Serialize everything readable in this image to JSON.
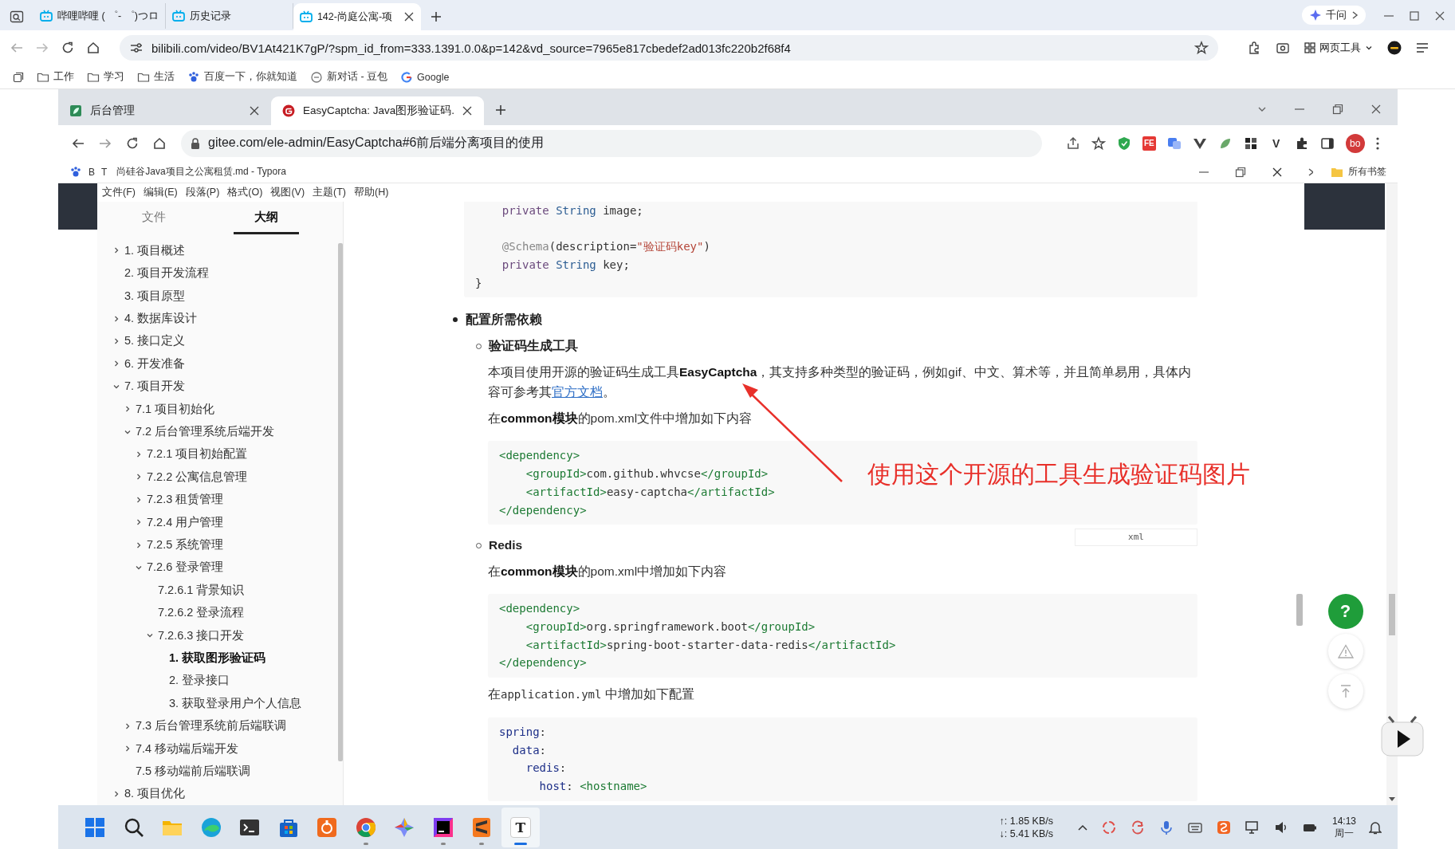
{
  "outer_browser": {
    "tabs": [
      {
        "title": "哔哩哔哩 ( ゜- ゜)つロ",
        "selected": false
      },
      {
        "title": "历史记录",
        "selected": false
      },
      {
        "title": "142-尚庭公寓-项",
        "selected": true
      }
    ],
    "assistant": "千问",
    "address": "bilibili.com/video/BV1At421K7gP/?spm_id_from=333.1391.0.0&p=142&vd_source=7965e817cbedef2ad013fc220b2f68f4",
    "tools_label": "网页工具",
    "bookmarks": [
      {
        "label": "工作",
        "kind": "folder"
      },
      {
        "label": "学习",
        "kind": "folder"
      },
      {
        "label": "生活",
        "kind": "folder"
      },
      {
        "label": "百度一下，你就知道",
        "kind": "baidu"
      },
      {
        "label": "新对话 - 豆包",
        "kind": "chat"
      },
      {
        "label": "Google",
        "kind": "google"
      }
    ]
  },
  "inner_browser": {
    "tabs": [
      {
        "title": "后台管理",
        "selected": false
      },
      {
        "title": "EasyCaptcha: Java图形验证码.",
        "selected": true
      }
    ],
    "address": "gitee.com/ele-admin/EasyCaptcha#6前后端分离项目的使用",
    "extensions": [
      {
        "kind": "shield"
      },
      {
        "kind": "badge",
        "text": "FE"
      },
      {
        "kind": "translate"
      },
      {
        "kind": "vue"
      },
      {
        "kind": "leaf"
      },
      {
        "kind": "blocks"
      },
      {
        "kind": "letter",
        "text": "V"
      },
      {
        "kind": "puzzle"
      },
      {
        "kind": "panel"
      }
    ],
    "profile": "bo",
    "bookmark_letters": [
      "B",
      "T"
    ],
    "all_bookmarks": "所有书签"
  },
  "typora": {
    "title": "尚硅谷Java项目之公寓租赁.md - Typora",
    "menu": [
      "文件(F)",
      "编辑(E)",
      "段落(P)",
      "格式(O)",
      "视图(V)",
      "主题(T)",
      "帮助(H)"
    ],
    "sidebar_tabs": [
      {
        "label": "文件",
        "selected": false
      },
      {
        "label": "大纲",
        "selected": true
      }
    ],
    "outline": [
      {
        "text": "1. 项目概述",
        "expanded": false,
        "selected": false
      },
      {
        "text": "2. 项目开发流程",
        "selected": false
      },
      {
        "text": "3. 项目原型",
        "selected": false
      },
      {
        "text": "4. 数据库设计",
        "expanded": false,
        "selected": false
      },
      {
        "text": "5. 接口定义",
        "expanded": false,
        "selected": false
      },
      {
        "text": "6. 开发准备",
        "expanded": false,
        "selected": false
      },
      {
        "text": "7. 项目开发",
        "expanded": true,
        "selected": false,
        "children": [
          {
            "text": "7.1 项目初始化",
            "expanded": false,
            "selected": false
          },
          {
            "text": "7.2 后台管理系统后端开发",
            "expanded": true,
            "selected": false,
            "children": [
              {
                "text": "7.2.1 项目初始配置",
                "expanded": false,
                "selected": false
              },
              {
                "text": "7.2.2 公寓信息管理",
                "expanded": false,
                "selected": false
              },
              {
                "text": "7.2.3 租赁管理",
                "expanded": false,
                "selected": false
              },
              {
                "text": "7.2.4 用户管理",
                "expanded": false,
                "selected": false
              },
              {
                "text": "7.2.5 系统管理",
                "expanded": false,
                "selected": false
              },
              {
                "text": "7.2.6 登录管理",
                "expanded": true,
                "selected": false,
                "children": [
                  {
                    "text": "7.2.6.1 背景知识",
                    "selected": false
                  },
                  {
                    "text": "7.2.6.2 登录流程",
                    "selected": false
                  },
                  {
                    "text": "7.2.6.3 接口开发",
                    "expanded": true,
                    "selected": false,
                    "children": [
                      {
                        "text": "1. 获取图形验证码",
                        "selected": true
                      },
                      {
                        "text": "2. 登录接口",
                        "selected": false
                      },
                      {
                        "text": "3. 获取登录用户个人信息",
                        "selected": false
                      }
                    ]
                  }
                ]
              }
            ]
          },
          {
            "text": "7.3 后台管理系统前后端联调",
            "expanded": false,
            "selected": false
          },
          {
            "text": "7.4 移动端后端开发",
            "expanded": false,
            "selected": false
          },
          {
            "text": "7.5 移动端前后端联调",
            "selected": false
          }
        ]
      },
      {
        "text": "8. 项目优化",
        "expanded": false,
        "selected": false
      }
    ],
    "blocks": [
      {
        "kind": "code",
        "groups": [
          [
            "    private String image;"
          ],
          [
            "    @Schema(description=\"验证码key\")",
            "    private String key;",
            "}"
          ]
        ]
      },
      {
        "kind": "bullet",
        "text": "配置所需依赖"
      },
      {
        "kind": "heading",
        "text": "验证码生成工具"
      },
      {
        "kind": "paragraph",
        "text": "本项目使用开源的验证码生成工具**EasyCaptcha**，其支持多种类型的验证码，例如gif、中文、算术等，并且简单易用，具体内容可参考其",
        "link": "官方文档",
        "tail": "。"
      },
      {
        "kind": "paragraph",
        "text": "在**common模块**的pom.xml文件中增加如下内容"
      },
      {
        "kind": "code",
        "tag": "xml",
        "groups": [
          [
            "<dependency>",
            "    <groupId>com.github.whvcse</groupId>",
            "    <artifactId>easy-captcha</artifactId>",
            "</dependency>"
          ]
        ]
      },
      {
        "kind": "heading",
        "text": "Redis"
      },
      {
        "kind": "paragraph",
        "text": "在**common模块**的pom.xml中增加如下内容"
      },
      {
        "kind": "code",
        "groups": [
          [
            "<dependency>",
            "    <groupId>org.springframework.boot</groupId>",
            "    <artifactId>spring-boot-starter-data-redis</artifactId>",
            "</dependency>"
          ]
        ]
      },
      {
        "kind": "paragraph",
        "text": "在",
        "code": "application.yml",
        "tail": " 中增加如下配置"
      },
      {
        "kind": "code",
        "groups": [
          [
            "spring:",
            "  data:",
            "    redis:",
            "      host: <hostname>"
          ]
        ]
      }
    ]
  },
  "annotation": "使用这个开源的工具生成验证码图片",
  "gitee": {
    "help": "?"
  },
  "taskbar": {
    "apps": [
      {
        "kind": "start",
        "running": false,
        "active": false
      },
      {
        "kind": "search",
        "running": false,
        "active": false
      },
      {
        "kind": "files",
        "running": false,
        "active": false
      },
      {
        "kind": "edge",
        "running": false,
        "active": false
      },
      {
        "kind": "terminal",
        "running": false,
        "active": false
      },
      {
        "kind": "store",
        "running": false,
        "active": false
      },
      {
        "kind": "orange",
        "running": false,
        "active": false
      },
      {
        "kind": "chrome",
        "running": true,
        "active": false
      },
      {
        "kind": "spark",
        "running": false,
        "active": false
      },
      {
        "kind": "ide",
        "running": true,
        "active": false
      },
      {
        "kind": "sublime",
        "running": true,
        "active": false
      },
      {
        "kind": "typora",
        "glyph": "T",
        "running": true,
        "active": true
      }
    ],
    "upload": "↑: 1.85 KB/s",
    "download": "↓: 5.41 KB/s",
    "time": "14:13",
    "day": "周一"
  }
}
